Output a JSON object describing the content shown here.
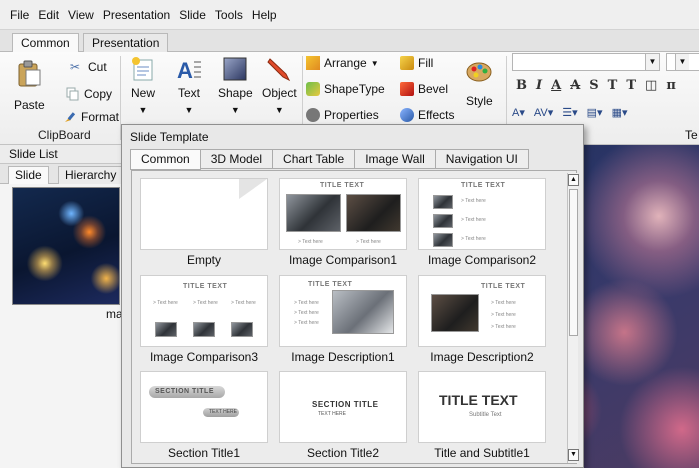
{
  "menu": [
    "File",
    "Edit",
    "View",
    "Presentation",
    "Slide",
    "Tools",
    "Help"
  ],
  "ribbon_tabs": [
    "Common",
    "Presentation"
  ],
  "clipboard": {
    "paste": "Paste",
    "cut": "Cut",
    "copy": "Copy",
    "format": "Format",
    "group_label": "ClipBoard"
  },
  "insert": {
    "new": "New",
    "text": "Text",
    "shape": "Shape",
    "object": "Object"
  },
  "arrange": {
    "arrange": "Arrange",
    "shapetype": "ShapeType",
    "properties": "Properties",
    "fill": "Fill",
    "bevel": "Bevel",
    "effects": "Effects",
    "style": "Style"
  },
  "font_group_label_cut": "Te",
  "side": {
    "slide_list": "Slide List",
    "tabs": [
      "Slide",
      "Hierarchy"
    ],
    "thumb_label": "ma"
  },
  "dropdown": {
    "title": "Slide Template",
    "tabs": [
      "Common",
      "3D Model",
      "Chart Table",
      "Image Wall",
      "Navigation UI"
    ],
    "templates": [
      {
        "label": "Empty"
      },
      {
        "label": "Image Comparison1",
        "title": "TITLE TEXT",
        "texts": [
          "> Text here",
          "> Text here"
        ]
      },
      {
        "label": "Image Comparison2",
        "title": "TITLE TEXT",
        "texts": [
          "> Text here",
          "> Text here",
          "> Text here"
        ]
      },
      {
        "label": "Image Comparison3",
        "title": "TITLE TEXT",
        "texts": [
          "> Text here",
          "> Text here",
          "> Text here"
        ]
      },
      {
        "label": "Image Description1",
        "title": "TITLE TEXT",
        "texts": [
          "> Text here",
          "> Text here",
          "> Text here"
        ]
      },
      {
        "label": "Image Description2",
        "title": "TITLE TEXT",
        "texts": [
          "> Text here",
          "> Text here",
          "> Text here"
        ]
      },
      {
        "label": "Section Title1",
        "title": "SECTION TITLE",
        "texts": [
          "TEXT HERE"
        ]
      },
      {
        "label": "Section Title2",
        "title": "SECTION TITLE",
        "texts": [
          "TEXT HERE"
        ]
      },
      {
        "label": "Title and Subtitle1",
        "title": "TITLE TEXT",
        "texts": [
          "Subtitle Text"
        ]
      }
    ]
  }
}
